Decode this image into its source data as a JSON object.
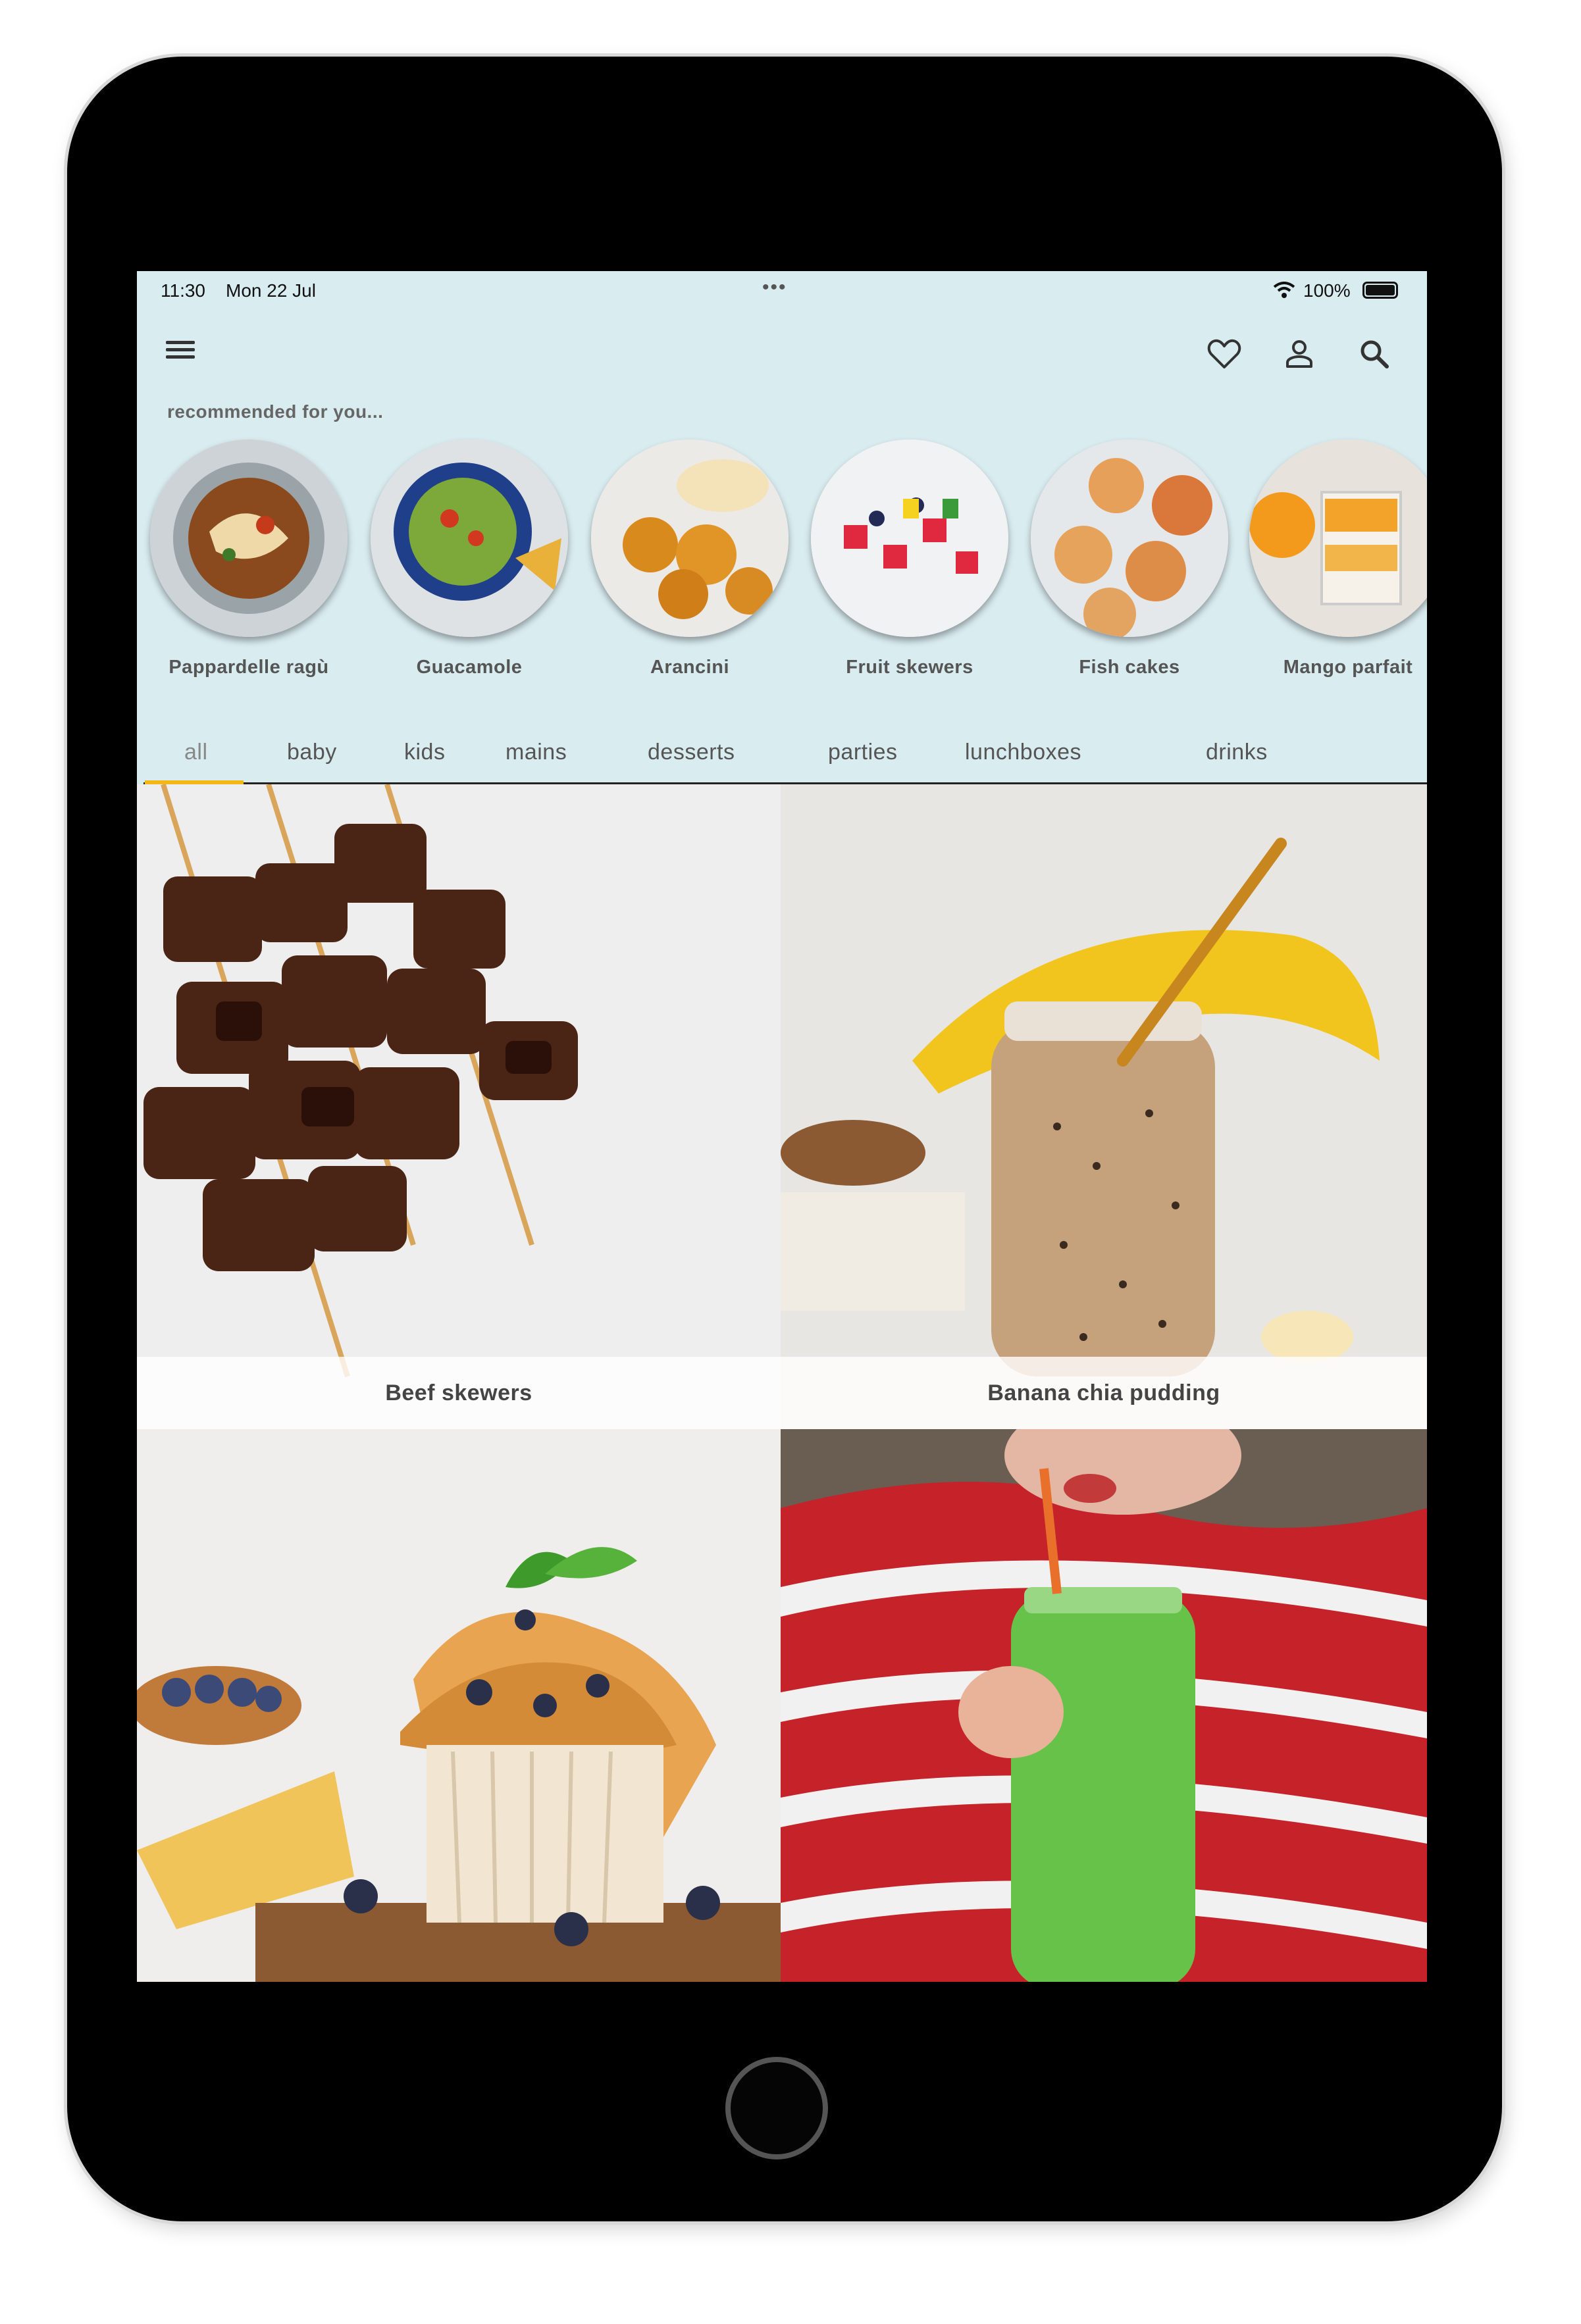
{
  "status_bar": {
    "time": "11:30",
    "date": "Mon 22 Jul",
    "dots": "•••",
    "battery": "100%"
  },
  "header": {
    "icons": [
      "menu-icon",
      "heart-icon",
      "user-icon",
      "search-icon"
    ]
  },
  "recommended": {
    "label": "recommended for you...",
    "items": [
      {
        "name": "Pappardelle ragù"
      },
      {
        "name": "Guacamole"
      },
      {
        "name": "Arancini"
      },
      {
        "name": "Fruit skewers"
      },
      {
        "name": "Fish cakes"
      },
      {
        "name": "Mango parfait"
      }
    ]
  },
  "tabs": [
    "all",
    "baby",
    "kids",
    "mains",
    "desserts",
    "parties",
    "lunchboxes",
    "drinks"
  ],
  "active_tab": "all",
  "recipes": [
    {
      "title": "Beef skewers"
    },
    {
      "title": "Banana chia pudding"
    },
    {
      "title": ""
    },
    {
      "title": ""
    }
  ],
  "colors": {
    "background": "#d9ecf0",
    "tab_accent": "#f3b718"
  }
}
